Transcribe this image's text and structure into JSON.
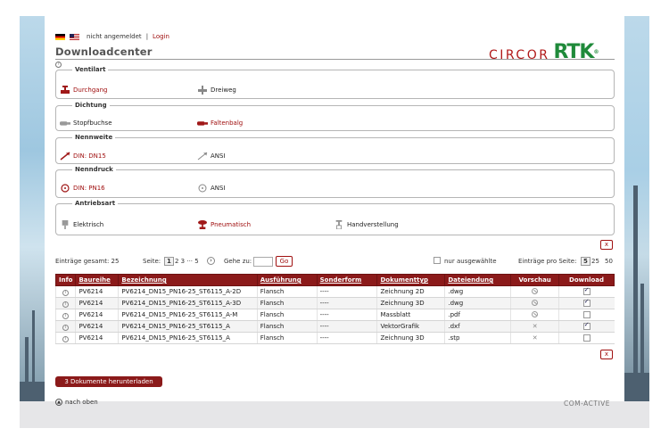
{
  "header": {
    "status_text": "nicht angemeldet",
    "separator": "|",
    "login_link": "Login",
    "title": "Downloadcenter",
    "help_icon": "?",
    "logo": {
      "circor": "CIRCOR",
      "rtk": "RTK",
      "reg": "®"
    },
    "colors": {
      "brand_red": "#8b1a1a",
      "rtk_green": "#1f8a3a"
    }
  },
  "filters": {
    "ventilart": {
      "legend": "Ventilart",
      "options": [
        "Durchgang",
        "Dreiweg"
      ],
      "selected": "Durchgang"
    },
    "dichtung": {
      "legend": "Dichtung",
      "options": [
        "Stopfbuchse",
        "Faltenbalg"
      ],
      "selected": "Faltenbalg"
    },
    "nennweite": {
      "legend": "Nennweite",
      "options": [
        "DIN: DN15",
        "ANSI"
      ],
      "selected": "DIN: DN15"
    },
    "nenndruck": {
      "legend": "Nenndruck",
      "options": [
        "DIN: PN16",
        "ANSI"
      ],
      "selected": "DIN: PN16"
    },
    "antriebsart": {
      "legend": "Antriebsart",
      "options": [
        "Elektrisch",
        "Pneumatisch",
        "Handverstellung"
      ],
      "selected": "Pneumatisch"
    }
  },
  "reset_button": "x",
  "pagination": {
    "total_label": "Einträge gesamt: 25",
    "page_label": "Seite:",
    "current_page": "1",
    "pages_rest": "2  3 ··· 5",
    "next_icon": "›",
    "goto_label": "Gehe zu:",
    "go_button": "Go",
    "only_selected_label": "nur ausgewählte",
    "per_page_label": "Einträge pro Seite:",
    "per_page_current": "5",
    "per_page_options": [
      "25",
      "50"
    ]
  },
  "table": {
    "headers": [
      "Info",
      "Baureihe",
      "Bezeichnung",
      "Ausführung",
      "Sonderform",
      "Dokumenttyp",
      "Dateiendung",
      "Vorschau",
      "Download"
    ],
    "rows": [
      {
        "baureihe": "PV6214",
        "bezeichnung": "PV6214_DN15_PN16-25_ST6115_A-2D",
        "ausfuehrung": "Flansch",
        "sonderform": "----",
        "dokumenttyp": "Zeichnung 2D",
        "dateiendung": ".dwg",
        "preview": "eye",
        "download": true
      },
      {
        "baureihe": "PV6214",
        "bezeichnung": "PV6214_DN15_PN16-25_ST6115_A-3D",
        "ausfuehrung": "Flansch",
        "sonderform": "----",
        "dokumenttyp": "Zeichnung 3D",
        "dateiendung": ".dwg",
        "preview": "eye",
        "download": true
      },
      {
        "baureihe": "PV6214",
        "bezeichnung": "PV6214_DN15_PN16-25_ST6115_A-M",
        "ausfuehrung": "Flansch",
        "sonderform": "----",
        "dokumenttyp": "Massblatt",
        "dateiendung": ".pdf",
        "preview": "eye",
        "download": false
      },
      {
        "baureihe": "PV6214",
        "bezeichnung": "PV6214_DN15_PN16-25_ST6115_A",
        "ausfuehrung": "Flansch",
        "sonderform": "----",
        "dokumenttyp": "VektorGrafik",
        "dateiendung": ".dxf",
        "preview": "cross",
        "download": true
      },
      {
        "baureihe": "PV6214",
        "bezeichnung": "PV6214_DN15_PN16-25_ST6115_A",
        "ausfuehrung": "Flansch",
        "sonderform": "----",
        "dokumenttyp": "Zeichnung 3D",
        "dateiendung": ".stp",
        "preview": "cross",
        "download": false
      }
    ]
  },
  "download_button": "3 Dokumente herunterladen",
  "back_to_top": "nach oben",
  "footer_brand": "COM-ACTIVE"
}
